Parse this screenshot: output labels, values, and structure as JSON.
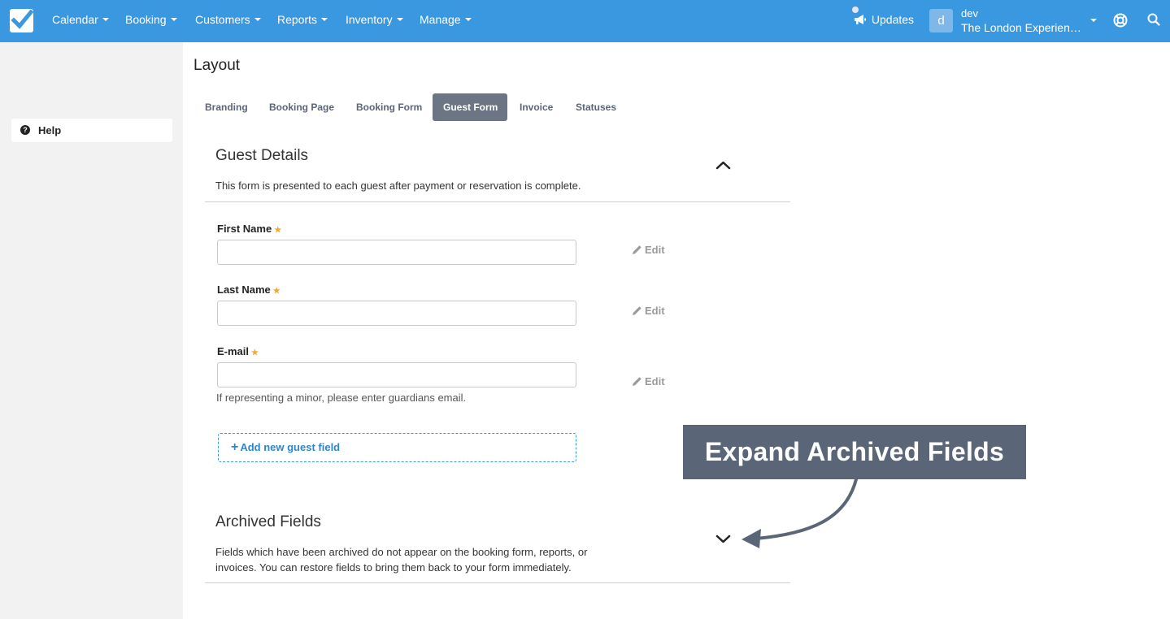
{
  "nav": {
    "items": [
      "Calendar",
      "Booking",
      "Customers",
      "Reports",
      "Inventory",
      "Manage"
    ],
    "updates_label": "Updates",
    "avatar_letter": "d",
    "user_name": "dev",
    "org_name": "The London Experience Ltd"
  },
  "sidebar": {
    "help_label": "Help"
  },
  "page": {
    "title": "Layout",
    "tabs": [
      "Branding",
      "Booking Page",
      "Booking Form",
      "Guest Form",
      "Invoice",
      "Statuses"
    ],
    "active_tab": "Guest Form"
  },
  "guest_details": {
    "title": "Guest Details",
    "description": "This form is presented to each guest after payment or reservation is complete.",
    "fields": [
      {
        "label": "First Name",
        "required": true,
        "value": "",
        "edit_label": "Edit"
      },
      {
        "label": "Last Name",
        "required": true,
        "value": "",
        "edit_label": "Edit"
      },
      {
        "label": "E-mail",
        "required": true,
        "value": "",
        "edit_label": "Edit",
        "help": "If representing a minor, please enter guardians email."
      }
    ],
    "add_field_label": "Add new guest field",
    "expanded": true
  },
  "archived": {
    "title": "Archived Fields",
    "description_line1": "Fields which have been archived do not appear on the booking form, reports, or",
    "description_line2": "invoices. You can restore fields to bring them back to your form immediately.",
    "expanded": false
  },
  "annotation": {
    "text": "Expand Archived Fields"
  },
  "colors": {
    "nav_bg": "#3a98e0",
    "active_tab_bg": "#6c7583",
    "required_star": "#f0a92b",
    "link": "#2f86cc",
    "callout_bg": "#5a6577"
  }
}
